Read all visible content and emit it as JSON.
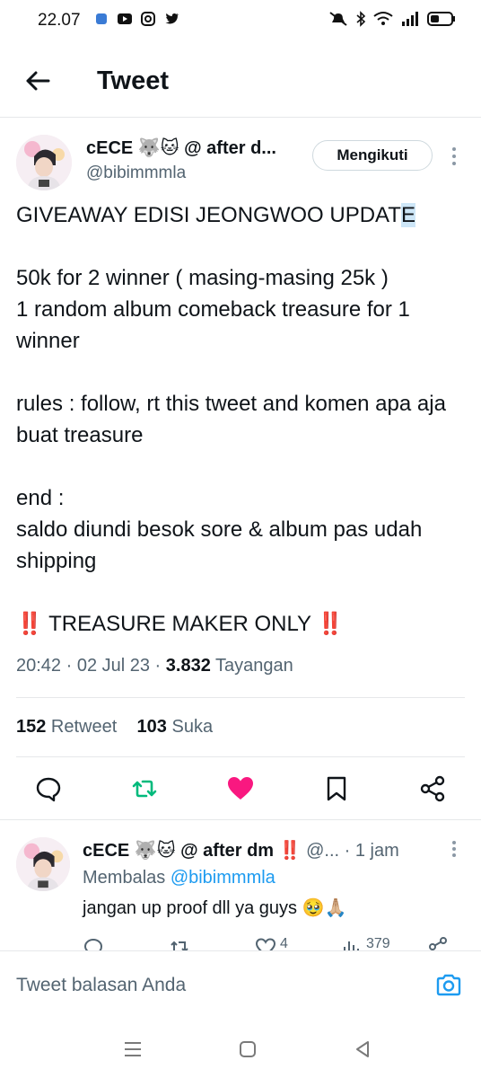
{
  "status_bar": {
    "time": "22.07"
  },
  "header": {
    "title": "Tweet"
  },
  "tweet": {
    "author_name": "cECE 🐺🐱 @ after d...",
    "author_handle": "@bibimmmla",
    "follow_label": "Mengikuti",
    "text_line1_main": "GIVEAWAY EDISI JEONGWOO UPDAT",
    "text_line1_highlight": "E",
    "text_para2": "50k for 2 winner ( masing-masing 25k )\n1 random album comeback treasure for 1 winner",
    "text_para3": "rules : follow, rt this tweet and komen apa aja buat treasure",
    "text_para4": "end :\nsaldo diundi besok sore & album pas udah shipping",
    "text_para5": "‼️ TREASURE MAKER ONLY ‼️",
    "timestamp": "20:42 · 02 Jul 23 · ",
    "views_count": "3.832",
    "views_label": " Tayangan",
    "retweet_count": "152",
    "retweet_label": " Retweet",
    "like_count": "103",
    "like_label": " Suka",
    "colors": {
      "retweet_active": "#00ba7c",
      "like_active": "#f91880",
      "link": "#1d9bf0",
      "secondary_text": "#536471"
    }
  },
  "reply": {
    "name": "cECE 🐺🐱 @ after dm ‼️",
    "handle": " @...",
    "time": " · 1 jam",
    "replying_prefix": "Membalas ",
    "replying_to": "@bibimmmla",
    "text": "jangan up proof dll ya guys 🥹🙏🏼",
    "like_count": "4",
    "view_count": "379"
  },
  "composer": {
    "placeholder": "Tweet balasan Anda"
  }
}
